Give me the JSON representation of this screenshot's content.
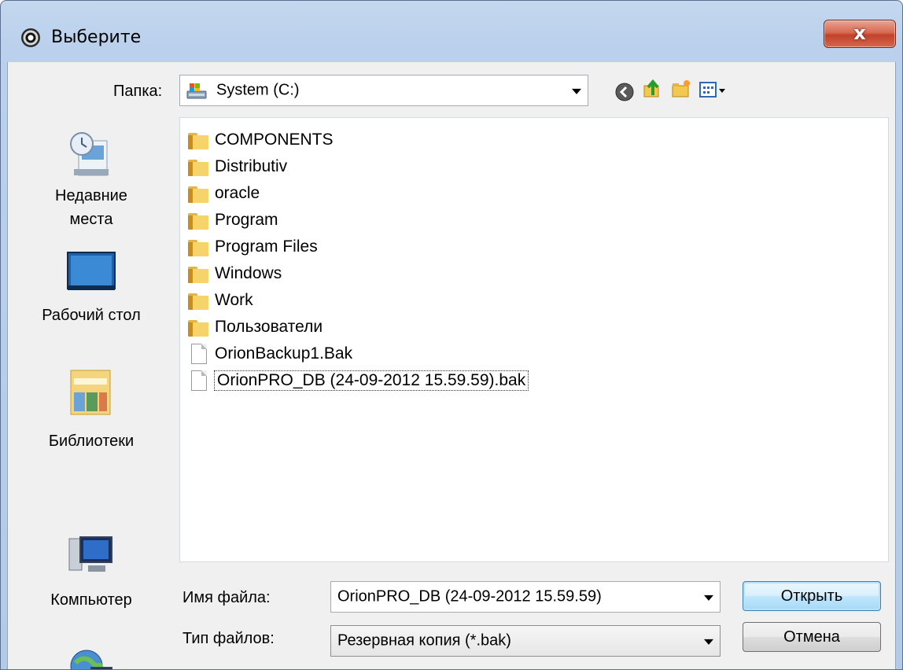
{
  "window": {
    "title": "Выберите",
    "close_glyph": "x"
  },
  "toolbar": {
    "folder_label": "Папка:",
    "folder_value": "System (C:)",
    "icons": [
      "back-icon",
      "up-folder-icon",
      "new-folder-icon",
      "view-menu-icon"
    ]
  },
  "places": [
    {
      "label_line1": "Недавние",
      "label_line2": "места",
      "icon": "recent-places-icon"
    },
    {
      "label_line1": "Рабочий стол",
      "label_line2": "",
      "icon": "desktop-icon"
    },
    {
      "label_line1": "Библиотеки",
      "label_line2": "",
      "icon": "libraries-icon"
    },
    {
      "label_line1": "Компьютер",
      "label_line2": "",
      "icon": "computer-icon"
    },
    {
      "label_line1": "",
      "label_line2": "",
      "icon": "network-icon"
    }
  ],
  "files": [
    {
      "name": "COMPONENTS",
      "type": "folder"
    },
    {
      "name": "Distributiv",
      "type": "folder"
    },
    {
      "name": "oracle",
      "type": "folder"
    },
    {
      "name": "Program",
      "type": "folder"
    },
    {
      "name": "Program Files",
      "type": "folder"
    },
    {
      "name": "Windows",
      "type": "folder"
    },
    {
      "name": "Work",
      "type": "folder"
    },
    {
      "name": "Пользователи",
      "type": "folder"
    },
    {
      "name": "OrionBackup1.Bak",
      "type": "file"
    },
    {
      "name": "OrionPRO_DB (24-09-2012 15.59.59).bak",
      "type": "file",
      "selected": true
    }
  ],
  "bottom": {
    "filename_label": "Имя файла:",
    "filename_value": "OrionPRO_DB (24-09-2012 15.59.59)",
    "filetype_label": "Тип файлов:",
    "filetype_value": "Резервная копия (*.bak)",
    "open_label": "Открыть",
    "cancel_label": "Отмена"
  },
  "colors": {
    "accent": "#3c7fb1",
    "close": "#c2412a",
    "frame": "#b4cbe8"
  }
}
